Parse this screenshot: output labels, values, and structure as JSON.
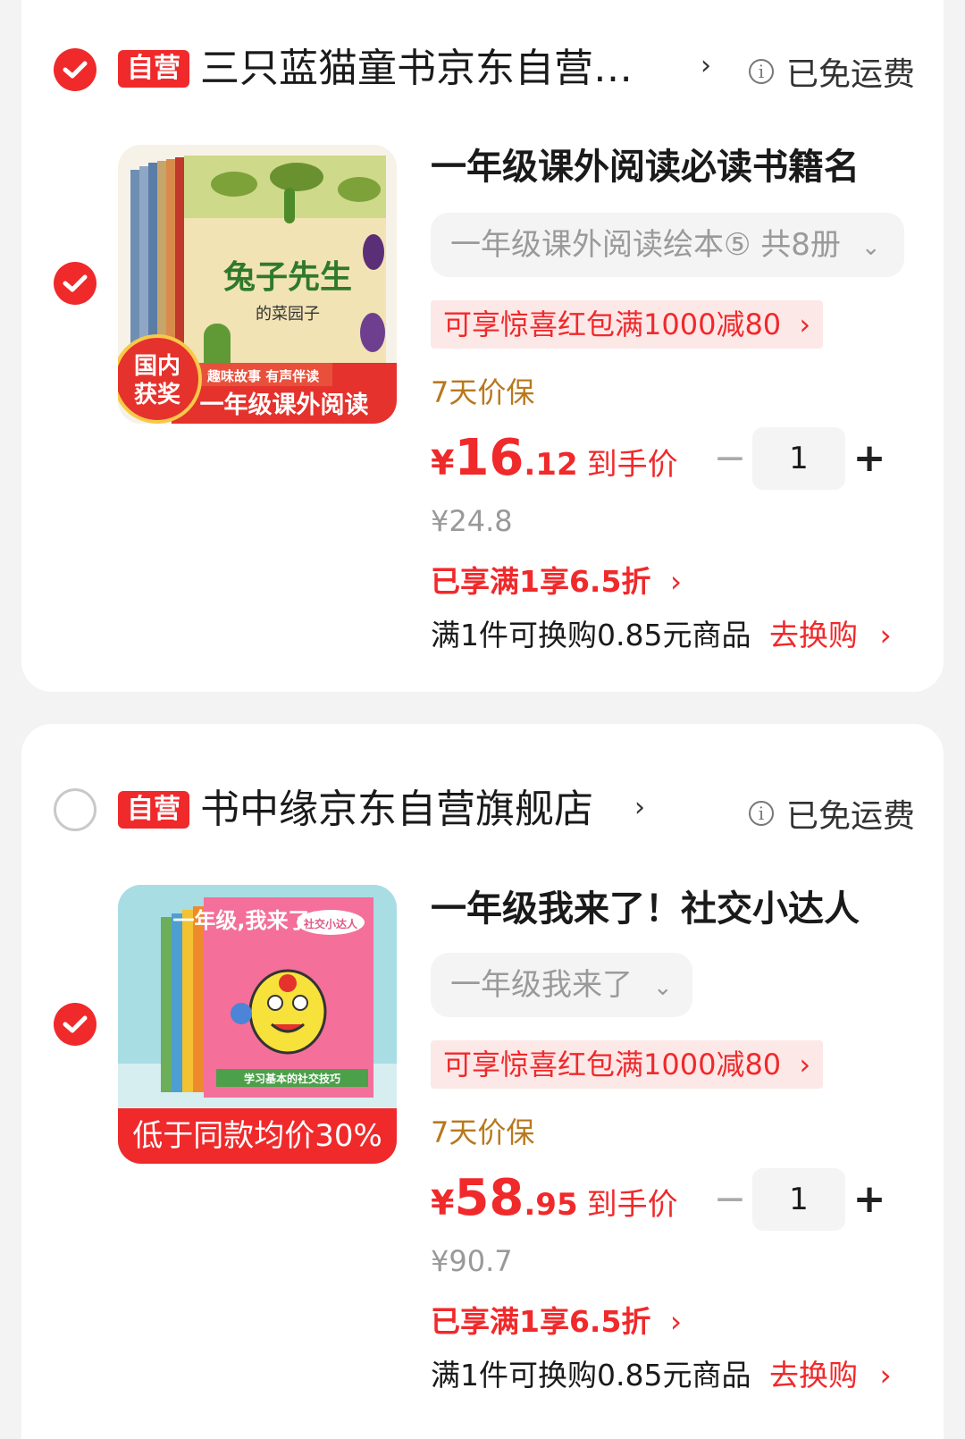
{
  "colors": {
    "accent": "#f0292b",
    "guarantee": "#b8781d",
    "muted": "#999999"
  },
  "shops": [
    {
      "badge": "自营",
      "name": "三只蓝猫童书京东自营…",
      "shipping": "已免运费",
      "checked": true,
      "item": {
        "title": "一年级课外阅读必读书籍名",
        "spec": "一年级课外阅读绘本⑤ 共8册",
        "coupon": "可享惊喜红包满1000减80",
        "guarantee": "7天价保",
        "price_symbol": "¥",
        "price_int": "16",
        "price_dec": ".12",
        "price_label": "到手价",
        "original_price": "¥24.8",
        "discount": "已享满1享6.5折",
        "swap_text": "满1件可换购0.85元商品",
        "swap_link": "去换购",
        "quantity": "1",
        "image": {
          "book_title": "兔子先生",
          "book_subtitle": "的菜园子",
          "award": [
            "国内",
            "获奖"
          ],
          "banner_top": "趣味故事 有声伴读",
          "banner_bottom": "一年级课外阅读"
        }
      }
    },
    {
      "badge": "自营",
      "name": "书中缘京东自营旗舰店",
      "shipping": "已免运费",
      "checked": false,
      "item": {
        "title": "一年级我来了！社交小达人",
        "spec": "一年级我来了",
        "coupon": "可享惊喜红包满1000减80",
        "guarantee": "7天价保",
        "price_symbol": "¥",
        "price_int": "58",
        "price_dec": ".95",
        "price_label": "到手价",
        "original_price": "¥90.7",
        "discount": "已享满1享6.5折",
        "swap_text": "满1件可换购0.85元商品",
        "swap_link": "去换购",
        "quantity": "1",
        "image": {
          "book_title": "一年级,我来了！",
          "bubble": "社交小达人",
          "footer": "学习基本的社交技巧",
          "ribbon": "低于同款均价30%"
        }
      }
    }
  ]
}
